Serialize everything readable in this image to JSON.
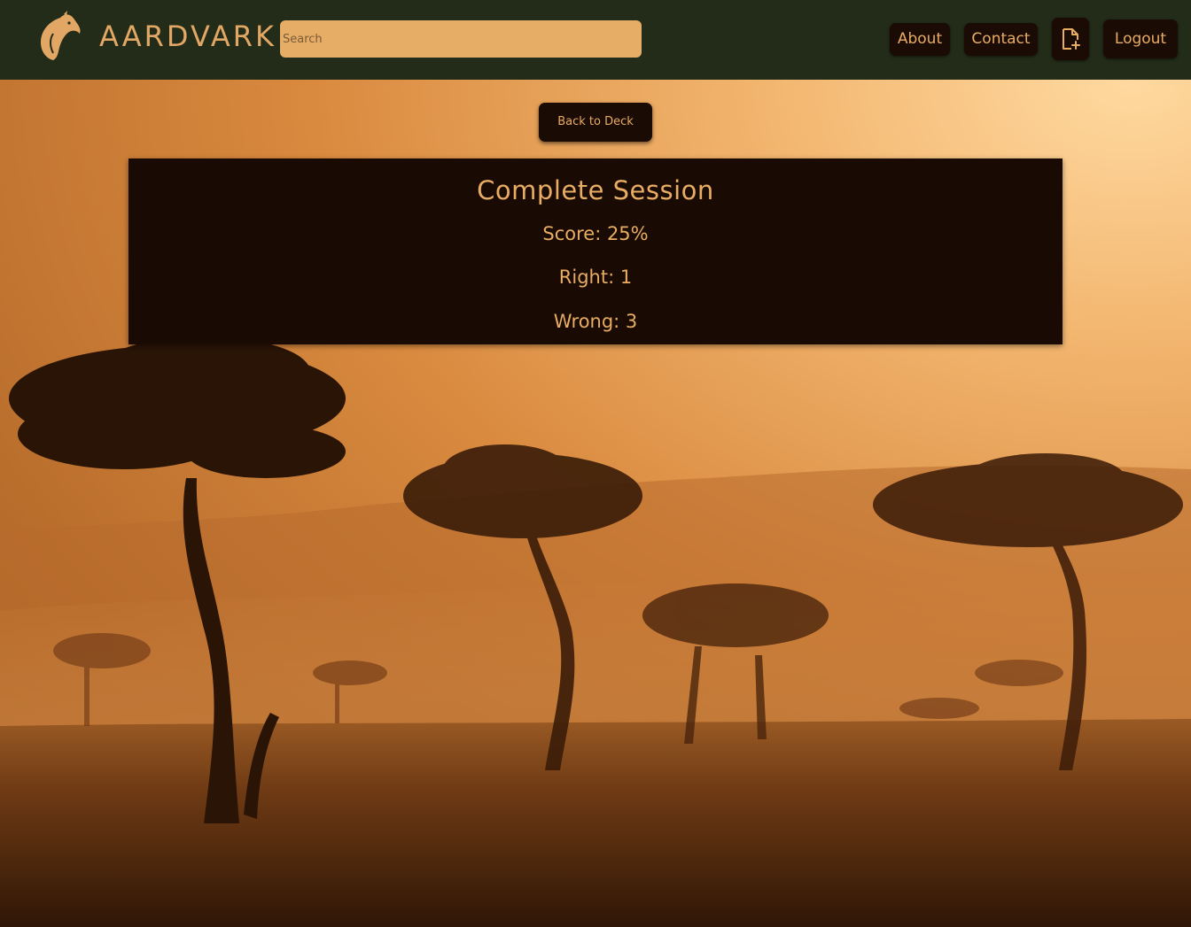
{
  "header": {
    "brand": "AARDVARK",
    "search_placeholder": "Search",
    "nav": {
      "about": "About",
      "contact": "Contact",
      "logout": "Logout"
    }
  },
  "main": {
    "back_button": "Back to Deck",
    "session": {
      "title": "Complete Session",
      "score": "Score: 25%",
      "right": "Right: 1",
      "wrong": "Wrong: 3"
    }
  },
  "colors": {
    "navbar_bg": "#232c19",
    "accent": "#e8ac63",
    "button_bg": "#1b0b05",
    "panel_bg": "#190b04"
  },
  "icons": [
    "aardvark-logo-icon",
    "add-file-icon"
  ]
}
